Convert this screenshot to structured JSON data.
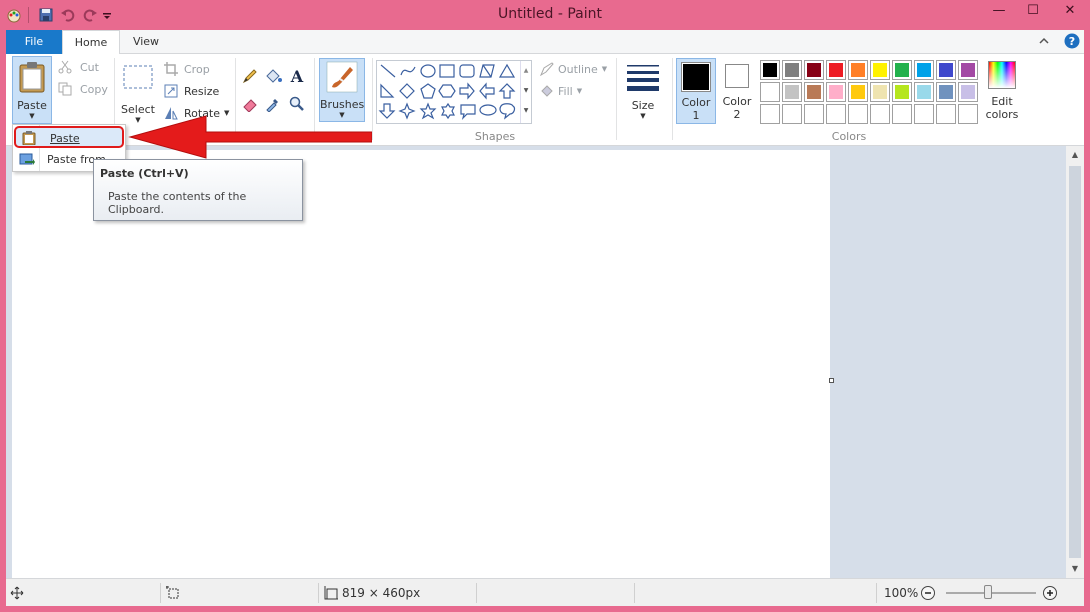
{
  "window": {
    "title": "Untitled - Paint",
    "minimize": "—",
    "maximize": "☐",
    "close": "✕"
  },
  "tabs": {
    "file": "File",
    "home": "Home",
    "view": "View"
  },
  "clipboard": {
    "paste": "Paste",
    "cut": "Cut",
    "copy": "Copy"
  },
  "image": {
    "select": "Select",
    "crop": "Crop",
    "resize": "Resize",
    "rotate": "Rotate"
  },
  "brushes": {
    "label": "Brushes"
  },
  "shapes": {
    "label": "Shapes",
    "outline": "Outline",
    "fill": "Fill"
  },
  "size": {
    "label": "Size"
  },
  "colors": {
    "label": "Colors",
    "color1_label": "Color",
    "color1_num": "1",
    "color2_label": "Color",
    "color2_num": "2",
    "edit_line1": "Edit",
    "edit_line2": "colors",
    "color1": "#000000",
    "color2": "#ffffff",
    "palette_row1": [
      "#000000",
      "#7f7f7f",
      "#880015",
      "#ed1c24",
      "#ff7f27",
      "#fff200",
      "#22b14c",
      "#00a2e8",
      "#3f48cc",
      "#a349a4"
    ],
    "palette_row2": [
      "#ffffff",
      "#c3c3c3",
      "#b97a57",
      "#ffaec9",
      "#ffc90e",
      "#efe4b0",
      "#b5e61d",
      "#99d9ea",
      "#7092be",
      "#c8bfe7"
    ]
  },
  "paste_menu": {
    "paste": "Paste",
    "paste_from": "Paste from"
  },
  "tooltip": {
    "title": "Paste (Ctrl+V)",
    "body": "Paste the contents of the Clipboard."
  },
  "status": {
    "canvas_size": "819 × 460px",
    "zoom": "100%"
  },
  "accent": "#e01b1b"
}
